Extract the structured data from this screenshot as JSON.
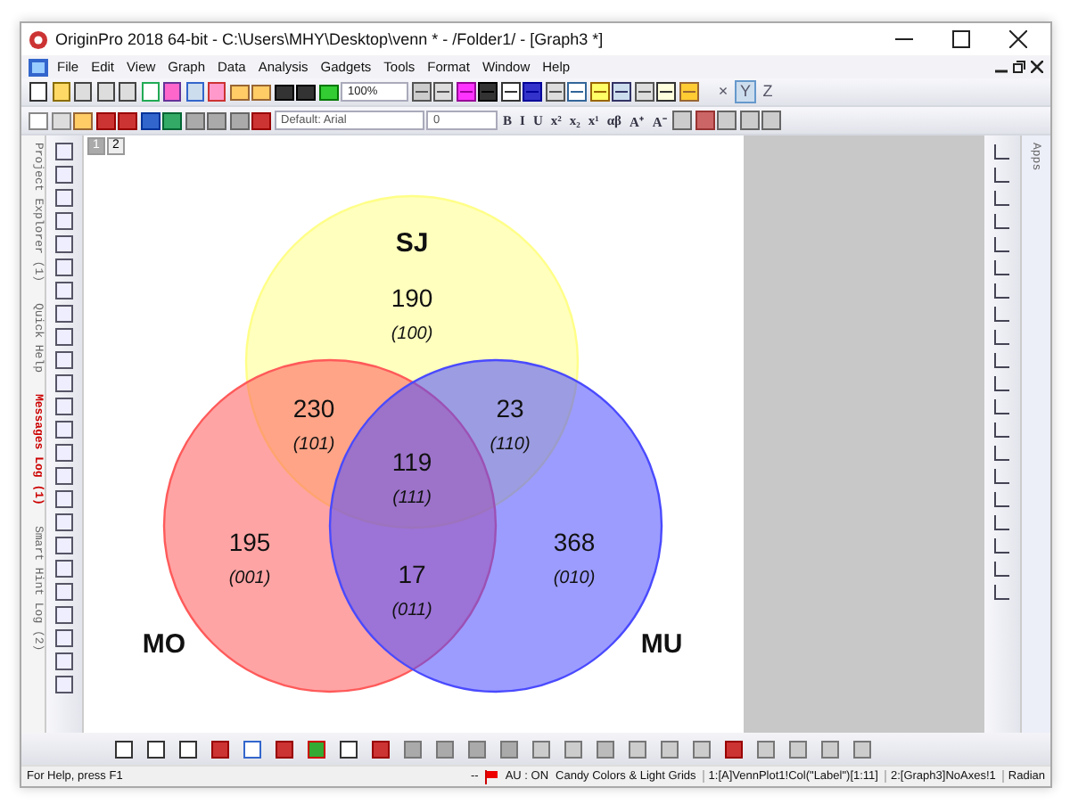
{
  "window": {
    "title": "OriginPro 2018 64-bit - C:\\Users\\MHY\\Desktop\\venn * - /Folder1/ - [Graph3 *]"
  },
  "menu": [
    "File",
    "Edit",
    "View",
    "Graph",
    "Data",
    "Analysis",
    "Gadgets",
    "Tools",
    "Format",
    "Window",
    "Help"
  ],
  "toolbar": {
    "zoom": "100%",
    "font": "Default: Arial",
    "font_size": "0",
    "axis_buttons": [
      {
        "label": "×",
        "selected": false
      },
      {
        "label": "Y",
        "selected": true
      },
      {
        "label": "Z",
        "selected": false
      }
    ],
    "format_buttons": [
      "B",
      "I",
      "U",
      "x²",
      "x₂",
      "x¹",
      "αβ",
      "A⁺",
      "A⁻"
    ]
  },
  "side_tabs": [
    {
      "label": "Project Explorer (1)",
      "highlighted": false
    },
    {
      "label": "Quick Help",
      "highlighted": false
    },
    {
      "label": "Messages Log (1)",
      "highlighted": true
    },
    {
      "label": "Smart Hint Log (2)",
      "highlighted": false
    }
  ],
  "right_tab": "Apps",
  "page_tabs": [
    {
      "label": "1",
      "selected": true
    },
    {
      "label": "2",
      "selected": false
    }
  ],
  "venn": {
    "sets": [
      {
        "label": "SJ",
        "color": "#ffff88"
      },
      {
        "label": "MO",
        "color": "#ff5a5a"
      },
      {
        "label": "MU",
        "color": "#4a4aff"
      }
    ],
    "regions": [
      {
        "count": "190",
        "code": "(100)"
      },
      {
        "count": "230",
        "code": "(101)"
      },
      {
        "count": "23",
        "code": "(110)"
      },
      {
        "count": "119",
        "code": "(111)"
      },
      {
        "count": "195",
        "code": "(001)"
      },
      {
        "count": "17",
        "code": "(011)"
      },
      {
        "count": "368",
        "code": "(010)"
      }
    ]
  },
  "status_bar": {
    "help": "For Help, press F1",
    "dashes": "--",
    "au": "AU : ON",
    "theme": "Candy Colors & Light Grids",
    "col": "1:[A]VennPlot1!Col(\"Label\")[1:11]",
    "layer": "2:[Graph3]NoAxes!1",
    "unit": "Radian"
  }
}
